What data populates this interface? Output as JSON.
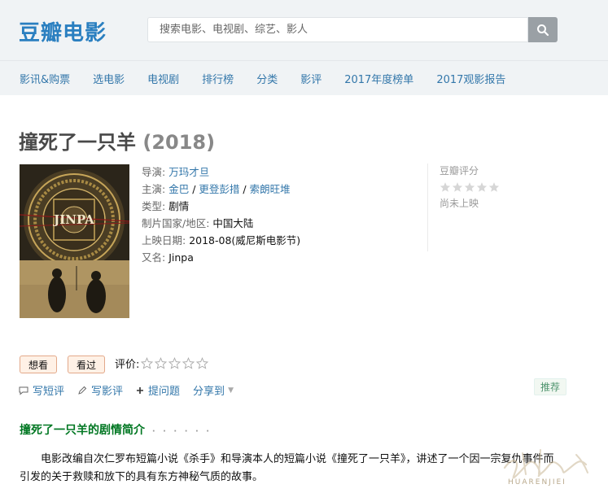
{
  "header": {
    "logo": "豆瓣电影",
    "search_placeholder": "搜索电影、电视剧、综艺、影人",
    "nav": [
      "影讯&购票",
      "选电影",
      "电视剧",
      "排行榜",
      "分类",
      "影评",
      "2017年度榜单",
      "2017观影报告"
    ]
  },
  "movie": {
    "title": "撞死了一只羊",
    "year": "(2018)",
    "poster_text": "JINPA",
    "info": {
      "director_label": "导演",
      "director": "万玛才旦",
      "cast_label": "主演",
      "cast": [
        "金巴",
        "更登彭措",
        "索朗旺堆"
      ],
      "genre_label": "类型",
      "genre": "剧情",
      "country_label": "制片国家/地区",
      "country": "中国大陆",
      "release_label": "上映日期",
      "release": "2018-08(威尼斯电影节)",
      "aka_label": "又名",
      "aka": "Jinpa"
    },
    "rating": {
      "label": "豆瓣评分",
      "note": "尚未上映",
      "stars": 0
    }
  },
  "interest": {
    "want_label": "想看",
    "seen_label": "看过",
    "rate_label": "评价:",
    "user_stars": 0
  },
  "actions": {
    "short_review": "写短评",
    "review": "写影评",
    "question": "提问题",
    "share": "分享到",
    "recommend": "推荐"
  },
  "synopsis": {
    "title": "撞死了一只羊的剧情简介",
    "dots": "· · · · · ·",
    "text": "电影改编自次仁罗布短篇小说《杀手》和导演本人的短篇小说《撞死了一只羊》，讲述了一个因一宗复仇事件而引发的关于救赎和放下的具有东方神秘气质的故事。"
  },
  "watermark": "HUARENJIEI",
  "colors": {
    "link": "#3377aa",
    "logo": "#2a7fc0",
    "section_title": "#007722"
  }
}
